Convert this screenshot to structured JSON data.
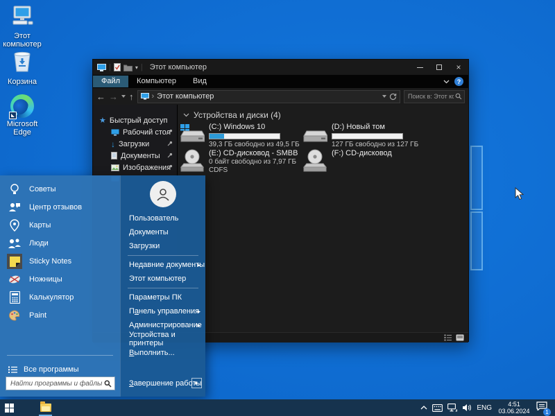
{
  "desktop": {
    "icons": [
      {
        "label": "Этот компьютер"
      },
      {
        "label": "Корзина"
      },
      {
        "label": "Microsoft Edge"
      }
    ]
  },
  "explorer": {
    "title": "Этот компьютер",
    "tabs": [
      {
        "label": "Файл"
      },
      {
        "label": "Компьютер"
      },
      {
        "label": "Вид"
      }
    ],
    "nav": {
      "address": "Этот компьютер",
      "search_placeholder": "Поиск в: Этот компьютер"
    },
    "sidebar": {
      "quick_access": "Быстрый доступ",
      "items": [
        {
          "label": "Рабочий стол"
        },
        {
          "label": "Загрузки"
        },
        {
          "label": "Документы"
        },
        {
          "label": "Изображения"
        }
      ]
    },
    "content": {
      "section_header": "Устройства и диски (4)",
      "drives": [
        {
          "name": "(C:) Windows 10",
          "capacity": "39,3 ГБ свободно из 49,5 ГБ",
          "used_percent": 21
        },
        {
          "name": "(D:) Новый том",
          "capacity": "127 ГБ свободно из 127 ГБ",
          "used_percent": 0
        },
        {
          "name": "(E:) CD-дисковод - SMBB",
          "capacity": "0 байт свободно из 7,97 ГБ",
          "filesystem": "CDFS"
        },
        {
          "name": "(F:) CD-дисковод"
        }
      ]
    }
  },
  "start_menu": {
    "apps": [
      {
        "label": "Советы"
      },
      {
        "label": "Центр отзывов"
      },
      {
        "label": "Карты"
      },
      {
        "label": "Люди"
      },
      {
        "label": "Sticky Notes"
      },
      {
        "label": "Ножницы"
      },
      {
        "label": "Калькулятор"
      },
      {
        "label": "Paint"
      }
    ],
    "all_programs": "Все программы",
    "search_placeholder": "Найти программы и файлы",
    "user_links": [
      {
        "label": "Пользователь"
      },
      {
        "label": "Документы"
      },
      {
        "label": "Загрузки"
      }
    ],
    "places": [
      {
        "label": "Недавние документы"
      },
      {
        "label": "Этот компьютер"
      }
    ],
    "system_links": [
      {
        "label": "Параметры ПК"
      },
      {
        "label": "Панель управления"
      },
      {
        "label": "Администрирование"
      },
      {
        "label": "Устройства и принтеры"
      },
      {
        "label": "Выполнить..."
      }
    ],
    "shutdown_label": "Завершение работы"
  },
  "taskbar": {
    "language": "ENG",
    "time": "4:51",
    "date": "03.06.2024",
    "notification_count": "1"
  },
  "colors": {
    "desktop_blue": "#0f6cd1",
    "taskbar": "#16334e",
    "start_menu_left": "#2e74b5",
    "start_menu_right": "#1b5a94",
    "file_tab": "#2b5b76",
    "drive_bar_fill": "#2d9bd8",
    "active_underline": "#6fb3e8"
  }
}
